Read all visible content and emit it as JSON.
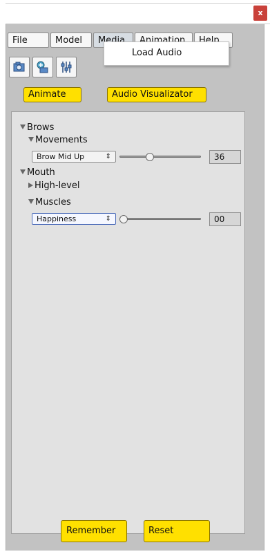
{
  "window": {
    "close_label": "x"
  },
  "menubar": {
    "items": [
      "File",
      "Model",
      "Media",
      "Animation",
      "Help"
    ],
    "active": "Media"
  },
  "dropdown": {
    "items": [
      "Load Audio"
    ]
  },
  "toolbar": {
    "icons": [
      "camera-icon",
      "camera-add-icon",
      "sliders-icon"
    ]
  },
  "top_buttons": {
    "animate_label": "Animate",
    "audio_visualizator_label": "Audio Visualizator"
  },
  "panel": {
    "brows": {
      "label": "Brows",
      "movements_label": "Movements",
      "select_value": "Brow Mid Up",
      "slider_value": 36,
      "value_text": "36"
    },
    "mouth": {
      "label": "Mouth",
      "high_level_label": "High-level",
      "muscles_label": "Muscles",
      "select_value": "Happiness",
      "slider_value": 0,
      "value_text": "00"
    }
  },
  "bottom_buttons": {
    "remember_label": "Remember",
    "reset_label": "Reset"
  },
  "colors": {
    "accent_yellow": "#ffe000",
    "close_red": "#c9413a",
    "panel_bg": "#e2e2e2",
    "window_bg": "#c2c2c2"
  }
}
